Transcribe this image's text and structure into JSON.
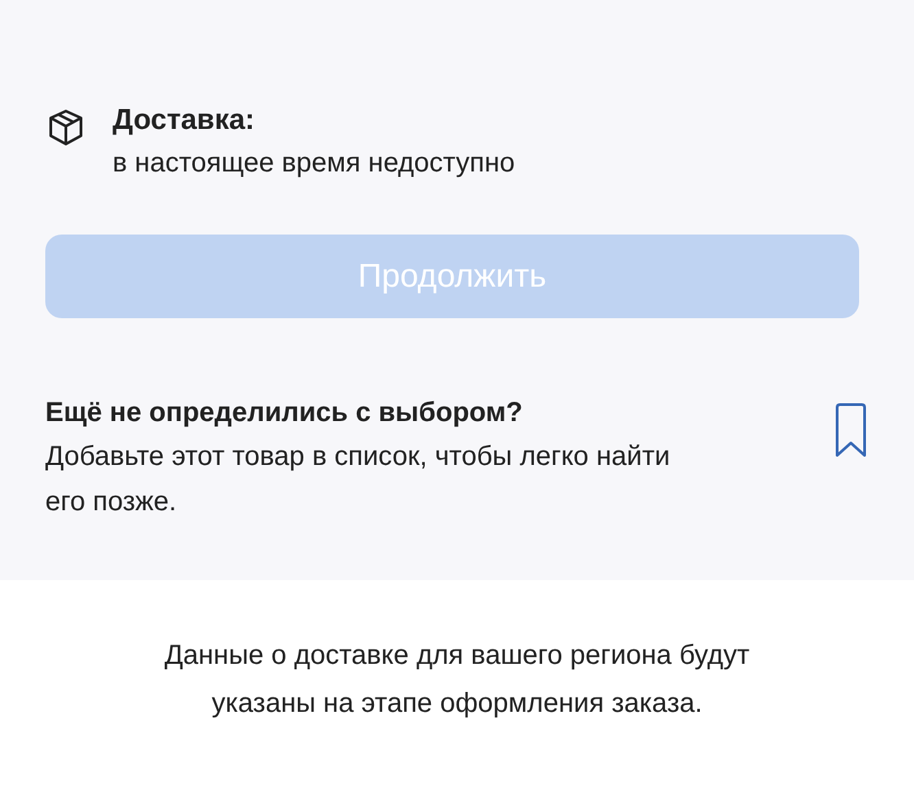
{
  "delivery": {
    "title": "Доставка:",
    "status": "в настоящее время недоступно"
  },
  "continue_button": {
    "label": "Продолжить",
    "disabled": true
  },
  "wishlist": {
    "title": "Ещё не определились с выбором?",
    "text": "Добавьте этот товар в список, чтобы легко найти его позже."
  },
  "footer_note": "Данные о доставке для вашего региона будут указаны на этапе оформления заказа."
}
